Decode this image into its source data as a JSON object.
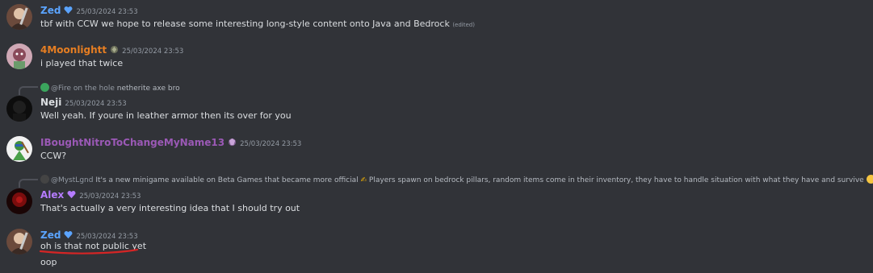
{
  "colors": {
    "zed": "#5ba4ff",
    "moonlight": "#e67e22",
    "nitro": "#9b59b6",
    "alex": "#b57cff",
    "neji": "#dbdee1",
    "annotation": "#d42525"
  },
  "messages": [
    {
      "author": "Zed",
      "timestamp": "25/03/2024 23:53",
      "text": "tbf with CCW we hope to release some interesting long-style content onto Java and Bedrock",
      "edited": "(edited)"
    },
    {
      "author": "4Moonlightt",
      "timestamp": "25/03/2024 23:53",
      "text": "i played that twice"
    },
    {
      "reply_author": "@Fire on the hole",
      "reply_text": "netherite axe bro",
      "author": "Neji",
      "timestamp": "25/03/2024 23:53",
      "text": "Well yeah. If youre in leather armor then its over for you"
    },
    {
      "author": "IBoughtNitroToChangeMyName13",
      "timestamp": "25/03/2024 23:53",
      "text": "CCW?"
    },
    {
      "reply_author": "@MystLgnd",
      "reply_text": "It's a new minigame available on Beta Games that became more official",
      "reply_text_2": "Players spawn on bedrock pillars, random items come in their inventory, they have to handle situation with what they have and survive",
      "author": "Alex",
      "timestamp": "25/03/2024 23:53",
      "text": "That's actually a very interesting idea that I should try out"
    },
    {
      "author": "Zed",
      "timestamp": "25/03/2024 23:53",
      "text": "oh is that not public yet",
      "text_2": "oop"
    }
  ]
}
